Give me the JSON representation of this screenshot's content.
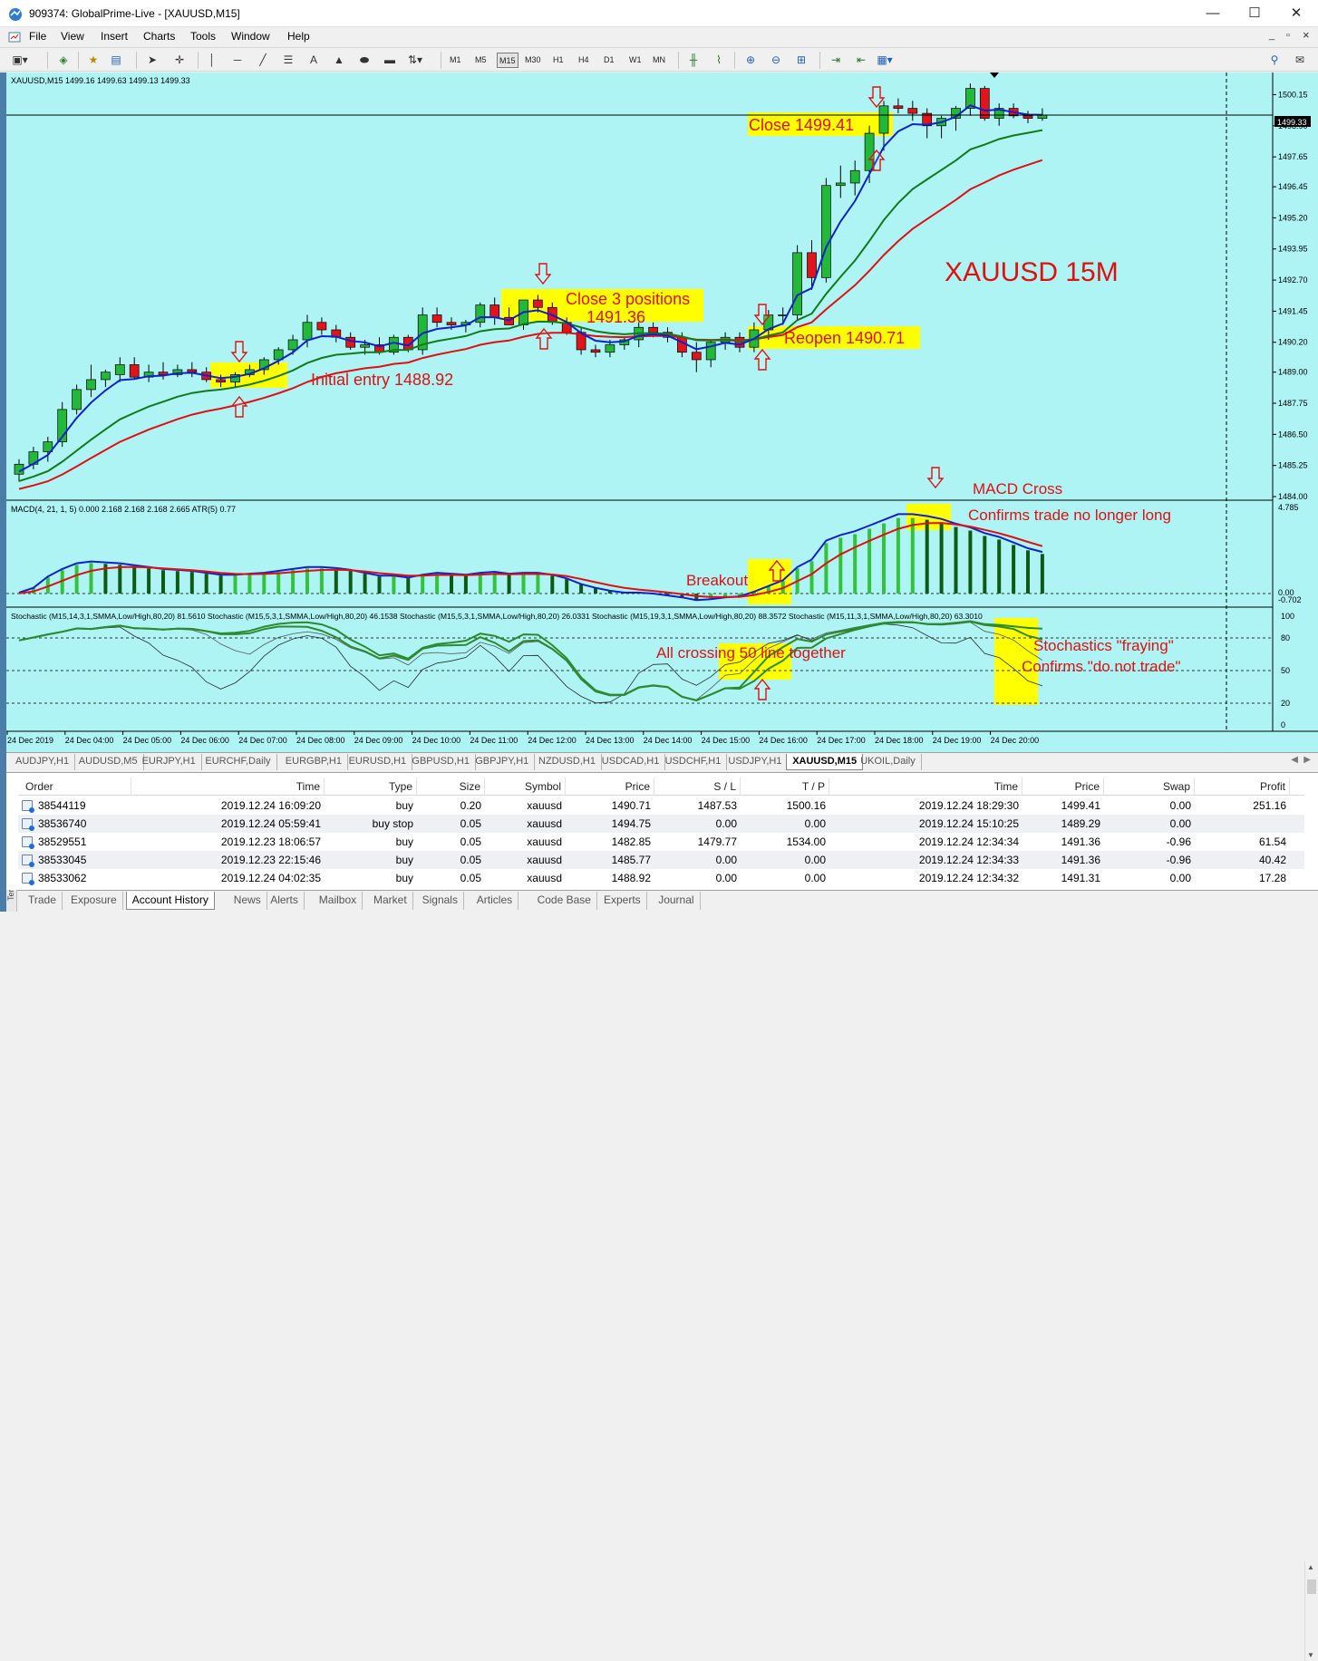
{
  "window": {
    "title": "909374: GlobalPrime-Live - [XAUUSD,M15]",
    "minimize": "—",
    "maximize": "☐",
    "close": "✕"
  },
  "menu": [
    "File",
    "View",
    "Insert",
    "Charts",
    "Tools",
    "Window",
    "Help"
  ],
  "mdi": {
    "minimize": "_",
    "restore": "▫",
    "close": "×"
  },
  "toolbar": {
    "timeframes": [
      "M1",
      "M5",
      "M15",
      "M30",
      "H1",
      "H4",
      "D1",
      "W1",
      "MN"
    ],
    "active_timeframe": "M15",
    "text_tool": "A"
  },
  "chart": {
    "header": "XAUUSD,M15  1499.16 1499.63 1499.13 1499.33",
    "current_price": "1499.33",
    "price_axis": [
      "1500.15",
      "1498.90",
      "1497.65",
      "1496.45",
      "1495.20",
      "1493.95",
      "1492.70",
      "1491.45",
      "1490.20",
      "1489.00",
      "1487.75",
      "1486.50",
      "1485.25",
      "1484.00"
    ],
    "macd_header": "MACD(4, 21, 1, 5) 0.000 2.168 2.168 2.168 2.665  ATR(5) 0.77",
    "macd_axis": [
      "4.785",
      "0.00",
      "-0.702"
    ],
    "stoch_header": "Stochastic (M15,14,3,1,SMMA,Low/High,80,20) 81.5610  Stochastic (M15,5,3,1,SMMA,Low/High,80,20) 46.1538  Stochastic (M15,5,3,1,SMMA,Low/High,80,20) 26.0331  Stochastic (M15,19,3,1,SMMA,Low/High,80,20) 88.3572  Stochastic (M15,11,3,1,SMMA,Low/High,80,20) 63.3010",
    "stoch_axis": [
      "100",
      "80",
      "50",
      "20",
      "0"
    ],
    "time_axis": [
      "24 Dec 2019",
      "24 Dec 04:00",
      "24 Dec 05:00",
      "24 Dec 06:00",
      "24 Dec 07:00",
      "24 Dec 08:00",
      "24 Dec 09:00",
      "24 Dec 10:00",
      "24 Dec 11:00",
      "24 Dec 12:00",
      "24 Dec 13:00",
      "24 Dec 14:00",
      "24 Dec 15:00",
      "24 Dec 16:00",
      "24 Dec 17:00",
      "24 Dec 18:00",
      "24 Dec 19:00",
      "24 Dec 20:00"
    ],
    "annotations": {
      "big_title": "XAUUSD 15M",
      "initial_entry": "Initial entry 1488.92",
      "close3_line1": "Close 3 positions",
      "close3_line2": "1491.36",
      "reopen": "Reopen 1490.71",
      "close_final": "Close 1499.41",
      "macd_cross": "MACD Cross",
      "macd_confirm": "Confirms trade no longer long",
      "breakout": "Breakout",
      "crossing50": "All crossing 50 line together",
      "fraying": "Stochastics \"fraying\"",
      "fraying_confirm": "Confirms \"do not trade\""
    },
    "colors": {
      "bg": "#aef4f5",
      "bull": "#22b83a",
      "bear": "#e0141b",
      "ma_fast": "#1020d0",
      "ma_mid": "#127a18",
      "ma_slow": "#e01010",
      "highlight": "#ffff00",
      "annotation": "#e01010"
    }
  },
  "chart_data": {
    "type": "candlestick",
    "title": "XAUUSD 15M",
    "xlabel": "",
    "ylabel": "",
    "ylim": [
      1484.0,
      1500.75
    ],
    "candles": [
      [
        1484.9,
        1485.5,
        1484.6,
        1485.3
      ],
      [
        1485.3,
        1486.0,
        1485.1,
        1485.8
      ],
      [
        1485.8,
        1486.4,
        1485.4,
        1486.2
      ],
      [
        1486.2,
        1487.8,
        1486.0,
        1487.5
      ],
      [
        1487.5,
        1488.5,
        1487.3,
        1488.3
      ],
      [
        1488.3,
        1489.3,
        1488.0,
        1488.7
      ],
      [
        1488.7,
        1489.1,
        1488.4,
        1489.0
      ],
      [
        1488.9,
        1489.6,
        1488.6,
        1489.3
      ],
      [
        1489.3,
        1489.6,
        1488.7,
        1488.8
      ],
      [
        1488.8,
        1489.3,
        1488.6,
        1489.0
      ],
      [
        1489.0,
        1489.4,
        1488.7,
        1488.9
      ],
      [
        1488.9,
        1489.3,
        1488.8,
        1489.1
      ],
      [
        1489.1,
        1489.4,
        1488.8,
        1489.0
      ],
      [
        1489.0,
        1489.2,
        1488.6,
        1488.7
      ],
      [
        1488.7,
        1488.9,
        1488.4,
        1488.6
      ],
      [
        1488.6,
        1489.0,
        1488.4,
        1488.9
      ],
      [
        1488.9,
        1489.3,
        1488.8,
        1489.1
      ],
      [
        1489.1,
        1489.6,
        1488.9,
        1489.5
      ],
      [
        1489.5,
        1490.0,
        1489.3,
        1489.9
      ],
      [
        1489.9,
        1490.5,
        1489.7,
        1490.3
      ],
      [
        1490.3,
        1491.3,
        1490.0,
        1491.0
      ],
      [
        1491.0,
        1491.2,
        1490.5,
        1490.7
      ],
      [
        1490.7,
        1490.9,
        1490.2,
        1490.4
      ],
      [
        1490.4,
        1490.6,
        1489.9,
        1490.0
      ],
      [
        1490.0,
        1490.3,
        1489.7,
        1490.1
      ],
      [
        1490.1,
        1490.4,
        1489.7,
        1489.8
      ],
      [
        1489.8,
        1490.5,
        1489.7,
        1490.4
      ],
      [
        1490.4,
        1490.5,
        1489.8,
        1489.9
      ],
      [
        1489.9,
        1491.6,
        1489.7,
        1491.3
      ],
      [
        1491.3,
        1491.6,
        1490.8,
        1491.0
      ],
      [
        1491.0,
        1491.2,
        1490.7,
        1490.9
      ],
      [
        1490.9,
        1491.1,
        1490.6,
        1491.0
      ],
      [
        1491.0,
        1491.8,
        1490.8,
        1491.7
      ],
      [
        1491.7,
        1492.0,
        1490.9,
        1491.2
      ],
      [
        1491.2,
        1491.6,
        1490.9,
        1490.9
      ],
      [
        1490.9,
        1491.9,
        1490.7,
        1491.9
      ],
      [
        1491.9,
        1492.1,
        1491.4,
        1491.6
      ],
      [
        1491.6,
        1491.8,
        1490.9,
        1491.0
      ],
      [
        1491.0,
        1491.2,
        1490.5,
        1490.6
      ],
      [
        1490.6,
        1490.8,
        1489.7,
        1489.9
      ],
      [
        1489.9,
        1490.1,
        1489.6,
        1489.8
      ],
      [
        1489.8,
        1490.3,
        1489.6,
        1490.1
      ],
      [
        1490.1,
        1490.4,
        1489.9,
        1490.3
      ],
      [
        1490.3,
        1491.0,
        1490.0,
        1490.8
      ],
      [
        1490.8,
        1491.0,
        1490.4,
        1490.6
      ],
      [
        1490.6,
        1490.8,
        1490.2,
        1490.4
      ],
      [
        1490.4,
        1490.6,
        1489.6,
        1489.8
      ],
      [
        1489.8,
        1490.2,
        1489.0,
        1489.5
      ],
      [
        1489.5,
        1490.3,
        1489.2,
        1490.2
      ],
      [
        1490.2,
        1490.6,
        1489.9,
        1490.4
      ],
      [
        1490.4,
        1490.6,
        1489.8,
        1490.0
      ],
      [
        1490.0,
        1491.0,
        1489.8,
        1490.7
      ],
      [
        1490.7,
        1491.5,
        1490.3,
        1491.3
      ],
      [
        1491.3,
        1491.6,
        1490.9,
        1491.3
      ],
      [
        1491.3,
        1494.1,
        1491.1,
        1493.8
      ],
      [
        1493.8,
        1494.3,
        1492.3,
        1492.8
      ],
      [
        1492.8,
        1496.8,
        1492.6,
        1496.5
      ],
      [
        1496.5,
        1497.3,
        1496.0,
        1496.6
      ],
      [
        1496.6,
        1497.5,
        1496.1,
        1497.1
      ],
      [
        1497.1,
        1498.9,
        1496.6,
        1498.6
      ],
      [
        1498.6,
        1499.9,
        1497.9,
        1499.7
      ],
      [
        1499.7,
        1500.0,
        1499.4,
        1499.6
      ],
      [
        1499.6,
        1499.9,
        1499.1,
        1499.4
      ],
      [
        1499.4,
        1499.6,
        1498.4,
        1498.9
      ],
      [
        1498.9,
        1499.3,
        1498.4,
        1499.2
      ],
      [
        1499.2,
        1499.7,
        1498.7,
        1499.6
      ],
      [
        1499.6,
        1500.6,
        1499.3,
        1500.4
      ],
      [
        1500.4,
        1500.5,
        1499.1,
        1499.2
      ],
      [
        1499.2,
        1499.8,
        1498.9,
        1499.6
      ],
      [
        1499.6,
        1499.8,
        1499.2,
        1499.3
      ],
      [
        1499.3,
        1499.5,
        1499.0,
        1499.2
      ],
      [
        1499.2,
        1499.6,
        1499.1,
        1499.33
      ]
    ],
    "macd_histogram": [
      0.05,
      0.3,
      0.9,
      1.3,
      1.6,
      1.7,
      1.65,
      1.6,
      1.5,
      1.4,
      1.3,
      1.25,
      1.2,
      1.1,
      1.0,
      1.0,
      1.05,
      1.1,
      1.2,
      1.3,
      1.4,
      1.4,
      1.35,
      1.25,
      1.1,
      0.95,
      0.95,
      0.85,
      1.0,
      1.1,
      1.05,
      1.0,
      1.1,
      1.15,
      1.05,
      1.1,
      1.1,
      1.0,
      0.8,
      0.5,
      0.3,
      0.15,
      0.05,
      0.05,
      0.0,
      -0.1,
      -0.2,
      -0.35,
      -0.3,
      -0.2,
      -0.15,
      0.1,
      0.4,
      0.7,
      1.4,
      1.8,
      2.8,
      3.1,
      3.3,
      3.6,
      3.9,
      4.2,
      4.2,
      4.1,
      3.95,
      3.7,
      3.5,
      3.2,
      3.0,
      2.7,
      2.4,
      2.2
    ],
    "stoch_levels": [
      80,
      50,
      20
    ]
  },
  "symbol_tabs": [
    "AUDJPY,H1",
    "AUDUSD,M5",
    "EURJPY,H1",
    "EURCHF,Daily",
    "EURGBP,H1",
    "EURUSD,H1",
    "GBPUSD,H1",
    "GBPJPY,H1",
    "NZDUSD,H1",
    "USDCAD,H1",
    "USDCHF,H1",
    "USDJPY,H1",
    "XAUUSD,M15",
    "UKOIL,Daily"
  ],
  "active_symbol_tab": "XAUUSD,M15",
  "terminal": {
    "side_label": "Terminal",
    "columns": [
      "Order",
      "Time",
      "Type",
      "Size",
      "Symbol",
      "Price",
      "S / L",
      "T / P",
      "Time",
      "Price",
      "Swap",
      "Profit"
    ],
    "rows": [
      [
        "38544119",
        "2019.12.24 16:09:20",
        "buy",
        "0.20",
        "xauusd",
        "1490.71",
        "1487.53",
        "1500.16",
        "2019.12.24 18:29:30",
        "1499.41",
        "0.00",
        "251.16"
      ],
      [
        "38536740",
        "2019.12.24 05:59:41",
        "buy stop",
        "0.05",
        "xauusd",
        "1494.75",
        "0.00",
        "0.00",
        "2019.12.24 15:10:25",
        "1489.29",
        "0.00",
        ""
      ],
      [
        "38529551",
        "2019.12.23 18:06:57",
        "buy",
        "0.05",
        "xauusd",
        "1482.85",
        "1479.77",
        "1534.00",
        "2019.12.24 12:34:34",
        "1491.36",
        "-0.96",
        "61.54"
      ],
      [
        "38533045",
        "2019.12.23 22:15:46",
        "buy",
        "0.05",
        "xauusd",
        "1485.77",
        "0.00",
        "0.00",
        "2019.12.24 12:34:33",
        "1491.36",
        "-0.96",
        "40.42"
      ],
      [
        "38533062",
        "2019.12.24 04:02:35",
        "buy",
        "0.05",
        "xauusd",
        "1488.92",
        "0.00",
        "0.00",
        "2019.12.24 12:34:32",
        "1491.31",
        "0.00",
        "17.28"
      ]
    ]
  },
  "bottom_tabs": [
    "Trade",
    "Exposure",
    "Account History",
    "News",
    "Alerts",
    "Mailbox",
    "Market",
    "Signals",
    "Articles",
    "Code Base",
    "Experts",
    "Journal"
  ],
  "active_bottom_tab": "Account History"
}
